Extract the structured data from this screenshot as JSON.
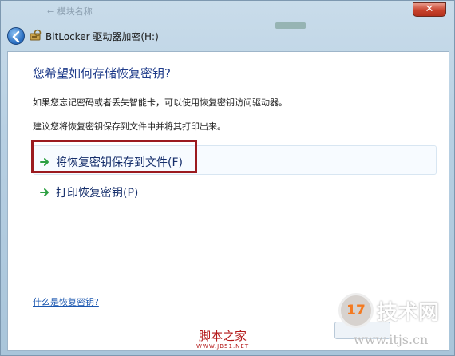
{
  "window": {
    "title": "BitLocker 驱动器加密(H:)",
    "background_title": "← 模块名称",
    "close_label": "✕"
  },
  "content": {
    "heading": "您希望如何存储恢复密钥?",
    "paragraph1": "如果您忘记密码或者丢失智能卡，可以使用恢复密钥访问驱动器。",
    "paragraph2": "建议您将恢复密钥保存到文件中并将其打印出来。",
    "options": [
      {
        "label": "将恢复密钥保存到文件(F)"
      },
      {
        "label": "打印恢复密钥(P)"
      }
    ],
    "help_link": "什么是恢复密钥?"
  },
  "watermarks": {
    "site_cn": "脚本之家",
    "site_small": "WWW.JB51.NET",
    "logo_number": "17",
    "logo_text": "技术网",
    "logo_url": "www.itjs.cn"
  },
  "colors": {
    "heading": "#1e3b8a",
    "link": "#1b57b0",
    "highlight_box": "#9b1a1f",
    "option_arrow": "#2ea043"
  },
  "icons": {
    "back": "back-arrow-icon",
    "title": "bitlocker-drive-icon",
    "option": "green-arrow-icon"
  }
}
